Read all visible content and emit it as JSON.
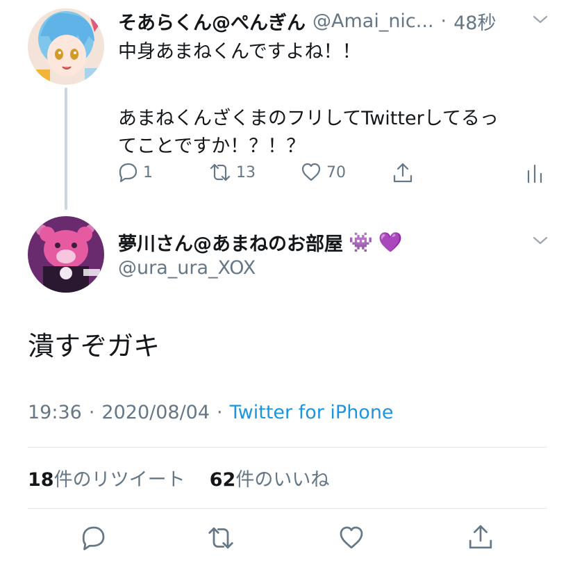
{
  "reply_tweet": {
    "display_name": "そあらくん@ぺんぎん",
    "handle": "@Amai_nic...",
    "separator": "·",
    "time_ago": "48秒",
    "lines": [
      "中身あまねくんですよね！！",
      "",
      "あまねくんざくまのフリしてTwitterしてるっ",
      "てことですか！？！？"
    ],
    "reply_count": "1",
    "retweet_count": "13",
    "like_count": "70"
  },
  "main_tweet": {
    "display_name": "夢川さん@あまねのお部屋",
    "name_emojis": [
      "👾",
      "💜"
    ],
    "handle": "@ura_ura_XOX",
    "text": "潰すぞガキ",
    "time": "19:36",
    "sep1": "·",
    "date": "2020/08/04",
    "sep2": "·",
    "source": "Twitter for iPhone",
    "retweets_num": "18",
    "retweets_label": "件のリツイート",
    "likes_num": "62",
    "likes_label": "件のいいね"
  },
  "colors": {
    "link": "#1b95e0",
    "secondary_text": "#657786",
    "divider": "#e1e8ed"
  }
}
